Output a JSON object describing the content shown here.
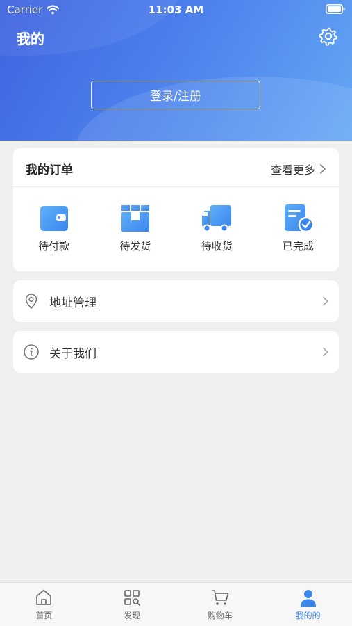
{
  "status_bar": {
    "carrier": "Carrier",
    "time": "11:03 AM"
  },
  "header": {
    "title": "我的",
    "login_label": "登录/注册"
  },
  "orders": {
    "title": "我的订单",
    "more_label": "查看更多",
    "items": [
      {
        "label": "待付款",
        "icon": "wallet-icon"
      },
      {
        "label": "待发货",
        "icon": "box-icon"
      },
      {
        "label": "待收货",
        "icon": "truck-icon"
      },
      {
        "label": "已完成",
        "icon": "completed-doc-icon"
      }
    ]
  },
  "menu": {
    "address": {
      "label": "地址管理",
      "icon": "location-pin-icon"
    },
    "about": {
      "label": "关于我们",
      "icon": "info-icon"
    }
  },
  "tabbar": {
    "items": [
      {
        "label": "首页",
        "icon": "home-icon"
      },
      {
        "label": "发现",
        "icon": "discover-grid-icon"
      },
      {
        "label": "购物车",
        "icon": "cart-icon"
      },
      {
        "label": "我的的",
        "icon": "person-icon"
      }
    ],
    "active_index": 3
  },
  "colors": {
    "accent": "#3b86e8",
    "header_start": "#3f63e0",
    "header_end": "#64a8f4"
  }
}
